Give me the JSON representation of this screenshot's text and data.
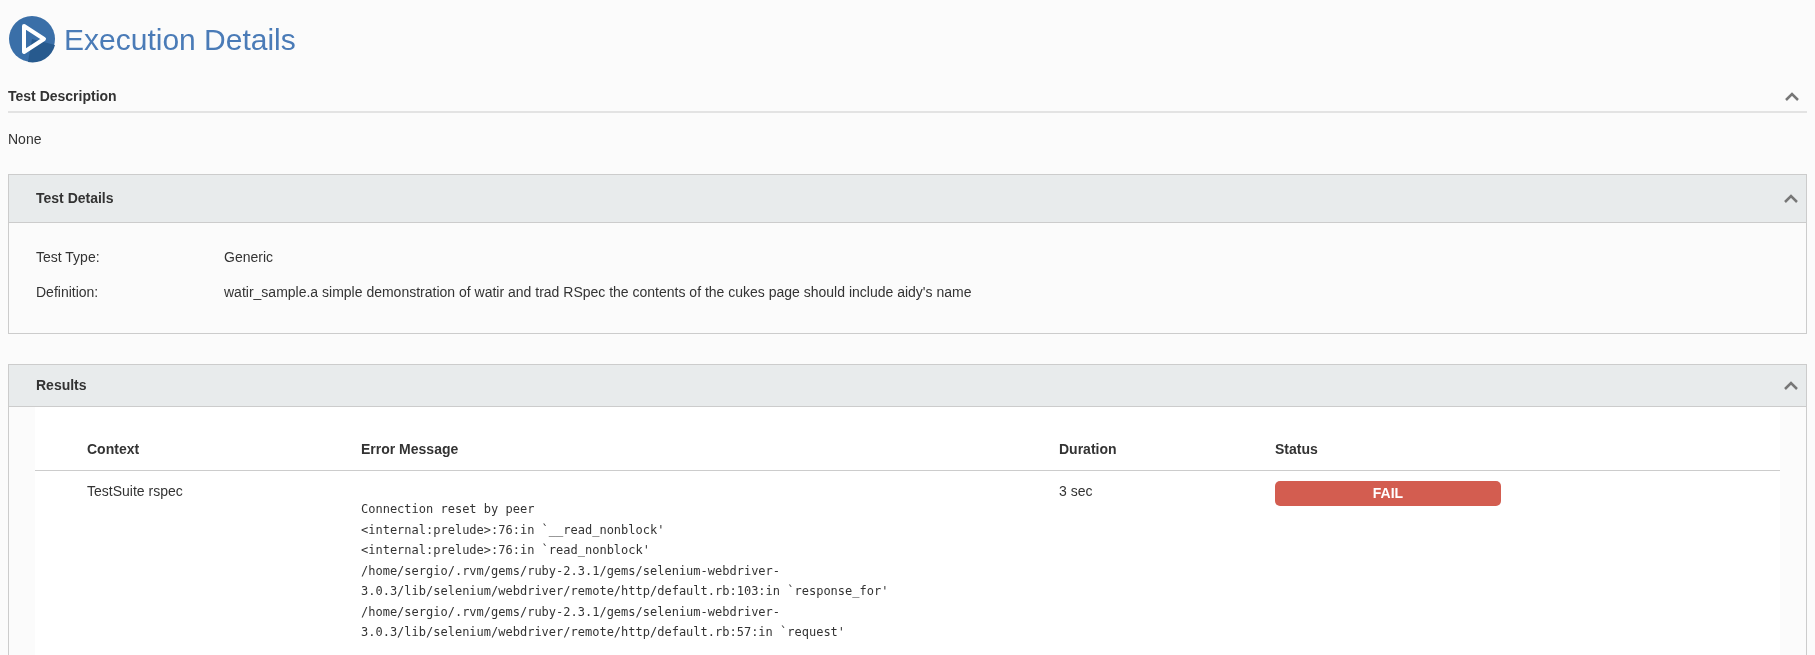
{
  "page_title": "Execution Details",
  "description": {
    "title": "Test Description",
    "expanded": true,
    "text": "None"
  },
  "details": {
    "title": "Test Details",
    "expanded": true,
    "fields": [
      {
        "label": "Test Type:",
        "value": "Generic"
      },
      {
        "label": "Definition:",
        "value": "watir_sample.a simple demonstration of watir and trad RSpec the contents of the cukes page should include aidy's name"
      }
    ]
  },
  "results": {
    "title": "Results",
    "expanded": true,
    "columns": [
      "Context",
      "Error Message",
      "Duration",
      "Status"
    ],
    "rows": [
      {
        "context": "TestSuite rspec",
        "error_lines": [
          "Connection reset by peer",
          "<internal:prelude>:76:in `__read_nonblock'",
          "<internal:prelude>:76:in `read_nonblock'",
          "/home/sergio/.rvm/gems/ruby-2.3.1/gems/selenium-webdriver-",
          "3.0.3/lib/selenium/webdriver/remote/http/default.rb:103:in `response_for'",
          "/home/sergio/.rvm/gems/ruby-2.3.1/gems/selenium-webdriver-",
          "3.0.3/lib/selenium/webdriver/remote/http/default.rb:57:in `request'"
        ],
        "duration": "3 sec",
        "status": "FAIL",
        "color": "#d35d50"
      }
    ]
  }
}
